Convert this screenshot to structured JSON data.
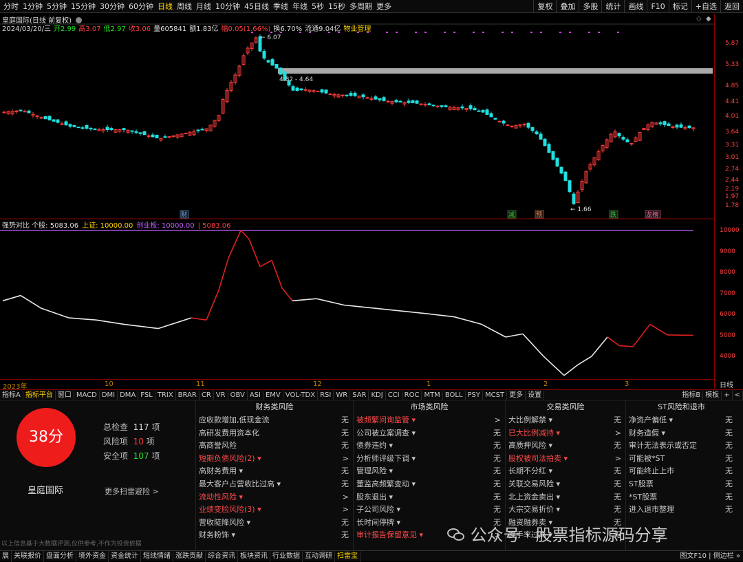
{
  "colors": {
    "up": "#ff3b3b",
    "down": "#20e0e0",
    "bg": "#000000",
    "accent": "#ffd400",
    "score": "#ef1c1c"
  },
  "topbar": {
    "periods": [
      "分时",
      "1分钟",
      "5分钟",
      "15分钟",
      "30分钟",
      "60分钟",
      "日线",
      "周线",
      "月线",
      "10分钟",
      "45日线",
      "季线",
      "年线",
      "5秒",
      "15秒",
      "多周期",
      "更多"
    ],
    "active": "日线",
    "tools": [
      "复权",
      "叠加",
      "多股",
      "统计",
      "画线",
      "F10",
      "标记",
      "+自选",
      "返回"
    ]
  },
  "chart": {
    "title": "皇庭国际(日线 前复权)",
    "info": [
      {
        "label": "2024/03/20/三",
        "color": "#dddddd"
      },
      {
        "label": "开2.99",
        "color": "#20e020"
      },
      {
        "label": "高3.07",
        "color": "#ff4040"
      },
      {
        "label": "低2.97",
        "color": "#20e020"
      },
      {
        "label": "收3.06",
        "color": "#ff4040"
      },
      {
        "label": "量605841",
        "color": "#dddddd"
      },
      {
        "label": "额1.83亿",
        "color": "#dddddd"
      },
      {
        "label": "幅0.05(1.66%)",
        "color": "#ff4040"
      },
      {
        "label": "换6.70%",
        "color": "#dddddd"
      },
      {
        "label": "流通9.04亿",
        "color": "#dddddd"
      },
      {
        "label": "物业管理",
        "color": "#ffd400"
      }
    ],
    "price_axis": [
      "5.87",
      "5.33",
      "4.85",
      "4.41",
      "4.01",
      "3.64",
      "3.31",
      "3.01",
      "2.74",
      "2.44",
      "2.19",
      "1.97",
      "1.78"
    ],
    "high_label": "6.07",
    "low_label": "1.66",
    "zone_label": "4.82 - 4.64",
    "event_markers": [
      {
        "text": "财",
        "color": "#6ab0ff"
      },
      {
        "text": "减",
        "color": "#30d030"
      },
      {
        "text": "预",
        "color": "#ff8040"
      },
      {
        "text": "跌",
        "color": "#30d030"
      },
      {
        "text": "龙榜",
        "color": "#ff60a0"
      }
    ]
  },
  "rs_chart": {
    "title": "强势对比 个股: 5083.06 上证: 10000.00 创业板: 10000.00 | 5083.06",
    "axis": [
      "10000",
      "9000",
      "8000",
      "7000",
      "6000",
      "5000",
      "4000"
    ]
  },
  "time_axis": [
    "2023年",
    "10",
    "11",
    "12",
    "1",
    "2",
    "3"
  ],
  "time_axis_right": "日线",
  "indicator_tabs": [
    "指标A",
    "指标平台",
    "窗口",
    "MACD",
    "DMI",
    "DMA",
    "FSL",
    "TRIX",
    "BRAR",
    "CR",
    "VR",
    "OBV",
    "ASI",
    "EMV",
    "VOL-TDX",
    "RSI",
    "WR",
    "SAR",
    "KDJ",
    "CCI",
    "ROC",
    "MTM",
    "BOLL",
    "PSY",
    "MCST",
    "更多",
    "设置"
  ],
  "indicator_active": "指标平台",
  "indicator_right": [
    "指标B",
    "模板",
    "+",
    "<"
  ],
  "risk": {
    "score": "38分",
    "stock_name": "皇庭国际",
    "total_label": "总检查",
    "total": "117",
    "total_unit": "项",
    "risk_label": "风险项",
    "risk": "10",
    "risk_unit": "项",
    "safe_label": "安全项",
    "safe": "107",
    "safe_unit": "项",
    "more": "更多扫雷避险 >",
    "disclaimer": "以上信息基于大数据评测,仅供参考,不作为投资依据",
    "columns": [
      {
        "title": "财务类风险",
        "items": [
          {
            "label": "应收款增加,低现金流",
            "status": "无",
            "risk": false
          },
          {
            "label": "高研发费用资本化",
            "status": "无",
            "risk": false
          },
          {
            "label": "高商誉风险",
            "status": "无",
            "risk": false
          },
          {
            "label": "短期负债风险(2) ▾",
            "status": ">",
            "risk": true
          },
          {
            "label": "高财务费用 ▾",
            "status": "无",
            "risk": false
          },
          {
            "label": "最大客户占营收比过高 ▾",
            "status": "无",
            "risk": false
          },
          {
            "label": "流动性风险 ▾",
            "status": ">",
            "risk": true
          },
          {
            "label": "业绩变脸风险(3) ▾",
            "status": ">",
            "risk": true
          },
          {
            "label": "营收陡降风险 ▾",
            "status": "无",
            "risk": false
          },
          {
            "label": "财务粉饰 ▾",
            "status": "无",
            "risk": false
          }
        ]
      },
      {
        "title": "市场类风险",
        "items": [
          {
            "label": "被频繁问询监管 ▾",
            "status": ">",
            "risk": true
          },
          {
            "label": "公司被立案调查 ▾",
            "status": "无",
            "risk": false
          },
          {
            "label": "债券违约 ▾",
            "status": "无",
            "risk": false
          },
          {
            "label": "分析师评级下调 ▾",
            "status": "无",
            "risk": false
          },
          {
            "label": "管理风险 ▾",
            "status": "无",
            "risk": false
          },
          {
            "label": "董监高频繁变动 ▾",
            "status": "无",
            "risk": false
          },
          {
            "label": "股东退出 ▾",
            "status": "无",
            "risk": false
          },
          {
            "label": "子公司风险 ▾",
            "status": "无",
            "risk": false
          },
          {
            "label": "长时间停牌 ▾",
            "status": "无",
            "risk": false
          },
          {
            "label": "审计报告保留意见 ▾",
            "status": ">",
            "risk": true
          }
        ]
      },
      {
        "title": "交易类风险",
        "items": [
          {
            "label": "大比例解禁 ▾",
            "status": "无",
            "risk": false
          },
          {
            "label": "已大比例减持 ▾",
            "status": ">",
            "risk": true
          },
          {
            "label": "高质押风险 ▾",
            "status": "无",
            "risk": false
          },
          {
            "label": "股权被司法拍卖 ▾",
            "status": ">",
            "risk": true
          },
          {
            "label": "长期不分红 ▾",
            "status": "无",
            "risk": false
          },
          {
            "label": "关联交易风险 ▾",
            "status": "无",
            "risk": false
          },
          {
            "label": "北上资金卖出 ▾",
            "status": "无",
            "risk": false
          },
          {
            "label": "大宗交易折价 ▾",
            "status": "无",
            "risk": false
          },
          {
            "label": "融资融券卖 ▾",
            "status": "无",
            "risk": false
          },
          {
            "label": "换手率过高 ▾",
            "status": "无",
            "risk": false
          }
        ]
      },
      {
        "title": "ST风险和退市",
        "items": [
          {
            "label": "净资产偏低 ▾",
            "status": "无",
            "risk": false
          },
          {
            "label": "财务造假 ▾",
            "status": "无",
            "risk": false
          },
          {
            "label": "审计无法表示或否定",
            "status": "无",
            "risk": false
          },
          {
            "label": "可能被*ST",
            "status": "无",
            "risk": false
          },
          {
            "label": "可能终止上市",
            "status": "无",
            "risk": false
          },
          {
            "label": "ST股票",
            "status": "无",
            "risk": false
          },
          {
            "label": "*ST股票",
            "status": "无",
            "risk": false
          },
          {
            "label": "进入退市整理",
            "status": "无",
            "risk": false
          }
        ]
      }
    ]
  },
  "watermark": "公众号 · 股票指标源码分享",
  "bottombar": {
    "tabs": [
      "展",
      "关联报价",
      "盘面分析",
      "境外资金",
      "资金统计",
      "短线情绪",
      "涨跌贡献",
      "综合资讯",
      "板块资讯",
      "行业数据",
      "互动调研",
      "扫雷宝"
    ],
    "active": "扫雷宝",
    "right": "图文F10 | 侧边栏 »"
  }
}
